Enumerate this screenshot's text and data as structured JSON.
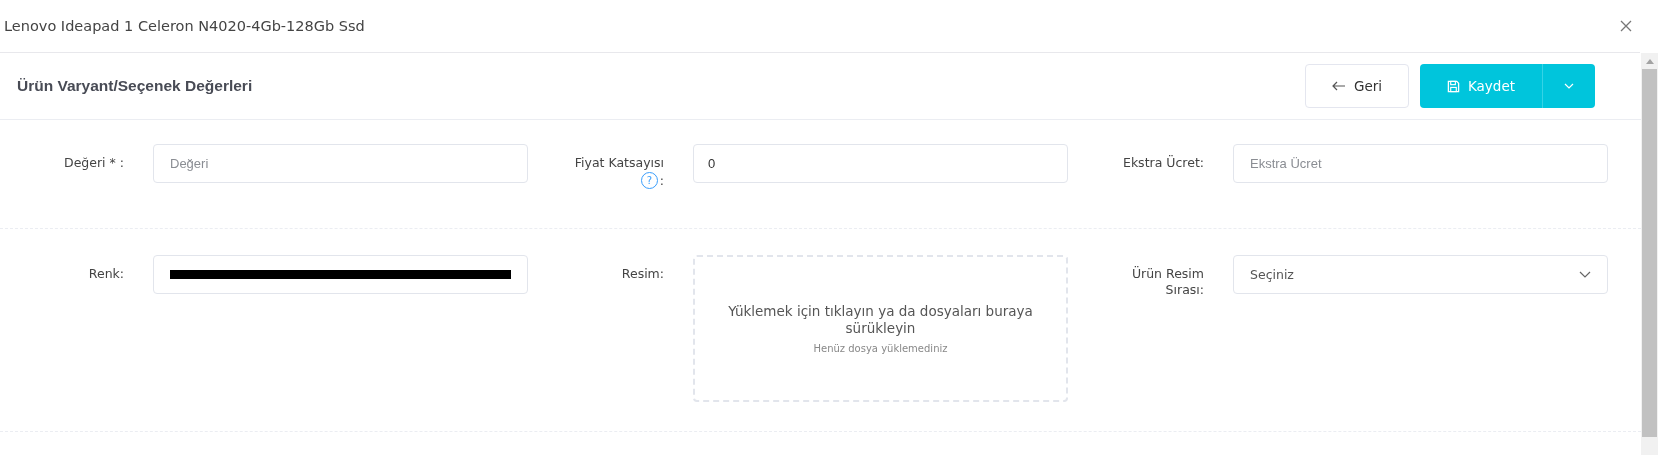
{
  "window": {
    "title": "Lenovo Ideapad 1 Celeron N4020-4Gb-128Gb Ssd"
  },
  "header": {
    "title": "Ürün Varyant/Seçenek Değerleri",
    "buttons": [
      {
        "kind": "back",
        "label": "Geri"
      },
      {
        "kind": "save",
        "label": "Kaydet"
      }
    ]
  },
  "rows": [
    [
      {
        "kind": "text",
        "label": "Değeri * :",
        "placeholder": "Değeri"
      },
      {
        "kind": "text",
        "label": "Fiyat Katsayısı",
        "help_icon": "?",
        "label_suffix": ":",
        "value": "0"
      },
      {
        "kind": "text",
        "label": "Ekstra Ücret:",
        "placeholder": "Ekstra Ücret"
      }
    ],
    [
      {
        "kind": "color",
        "label": "Renk:",
        "color": "#000000"
      },
      {
        "kind": "upload",
        "label": "Resim:",
        "text": "Yüklemek için tıklayın ya da dosyaları buraya sürükleyin",
        "hint": "Henüz dosya yüklemediniz"
      },
      {
        "kind": "select",
        "label": "Ürün Resim Sırası:",
        "value": "Seçiniz"
      }
    ]
  ]
}
